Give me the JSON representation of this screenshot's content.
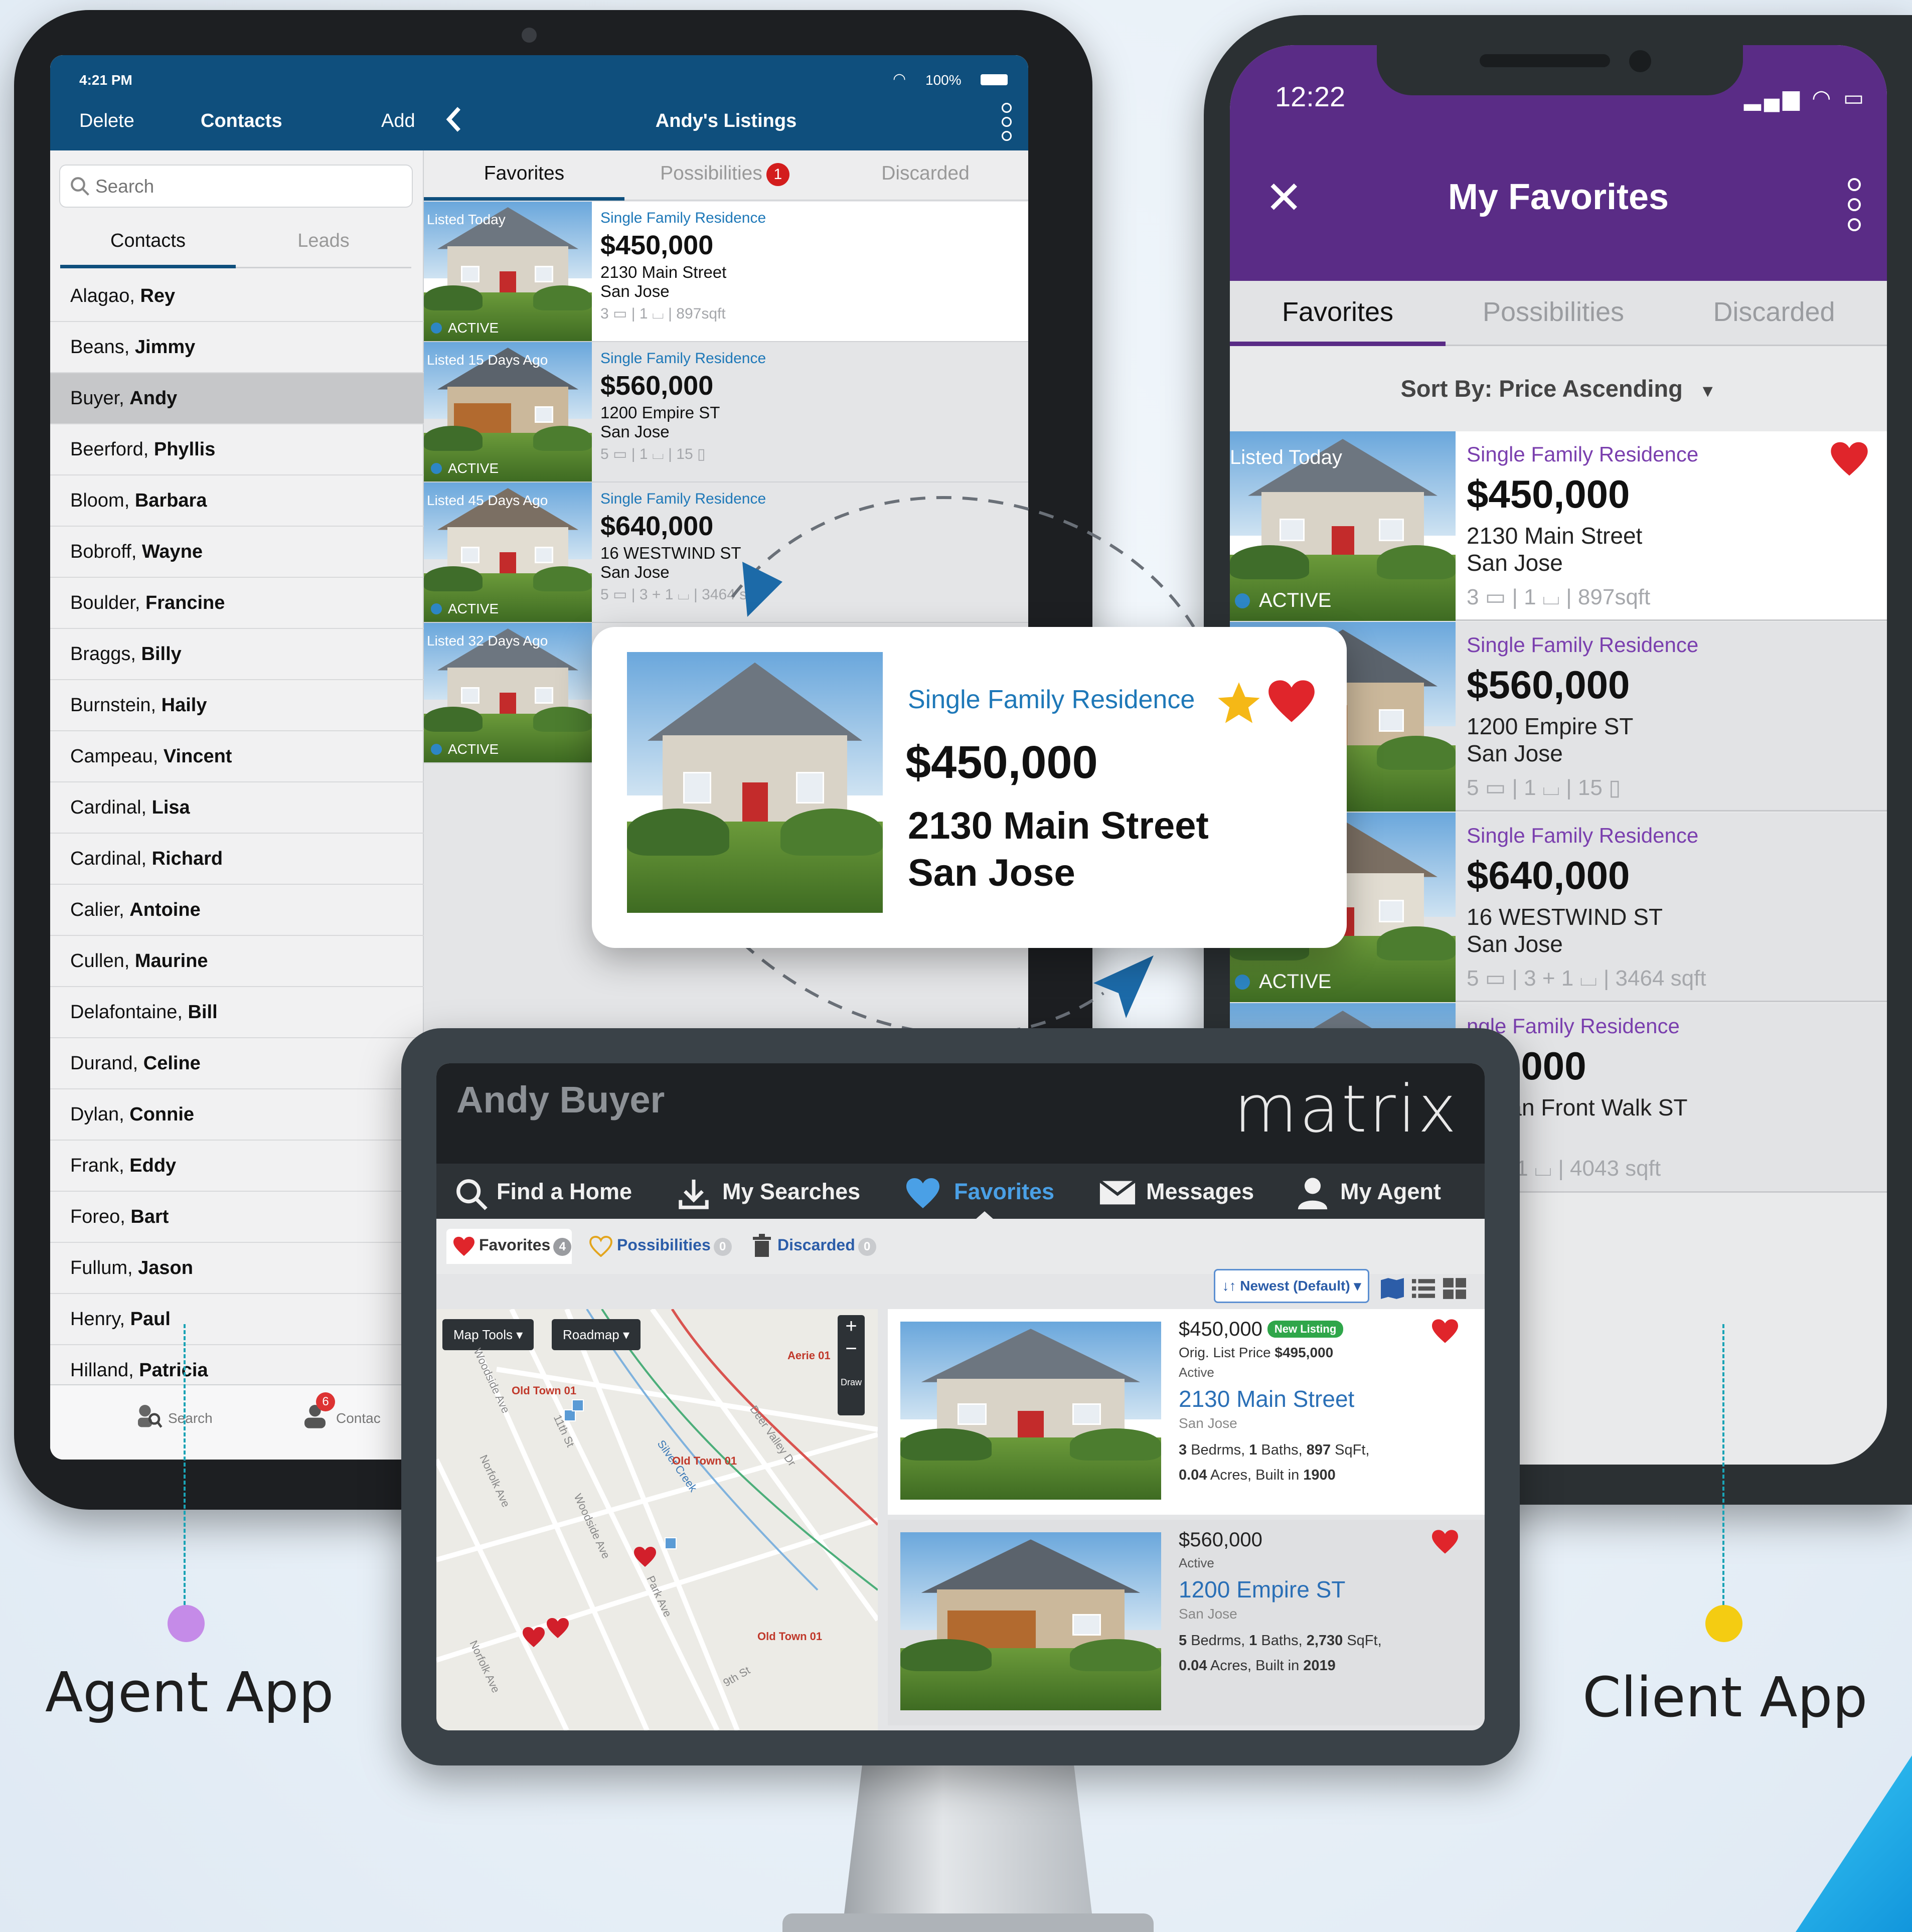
{
  "agent_app": {
    "status": {
      "time": "4:21 PM",
      "battery": "100%"
    },
    "left_header": {
      "delete": "Delete",
      "title": "Contacts",
      "add": "Add"
    },
    "search_placeholder": "Search",
    "segments": [
      "Contacts",
      "Leads"
    ],
    "contacts": [
      {
        "last": "Alagao",
        "first": "Rey",
        "selected": false
      },
      {
        "last": "Beans",
        "first": "Jimmy",
        "selected": false
      },
      {
        "last": "Buyer",
        "first": "Andy",
        "selected": true
      },
      {
        "last": "Beerford",
        "first": "Phyllis",
        "selected": false
      },
      {
        "last": "Bloom",
        "first": "Barbara",
        "selected": false
      },
      {
        "last": "Bobroff",
        "first": "Wayne",
        "selected": false
      },
      {
        "last": "Boulder",
        "first": "Francine",
        "selected": false
      },
      {
        "last": "Braggs",
        "first": "Billy",
        "selected": false
      },
      {
        "last": "Burnstein",
        "first": "Haily",
        "selected": false
      },
      {
        "last": "Campeau",
        "first": "Vincent",
        "selected": false
      },
      {
        "last": "Cardinal",
        "first": "Lisa",
        "selected": false
      },
      {
        "last": "Cardinal",
        "first": "Richard",
        "selected": false
      },
      {
        "last": "Calier",
        "first": "Antoine",
        "selected": false
      },
      {
        "last": "Cullen",
        "first": "Maurine",
        "selected": false
      },
      {
        "last": "Delafontaine",
        "first": "Bill",
        "selected": false
      },
      {
        "last": "Durand",
        "first": "Celine",
        "selected": false
      },
      {
        "last": "Dylan",
        "first": "Connie",
        "selected": false
      },
      {
        "last": "Frank",
        "first": "Eddy",
        "selected": false
      },
      {
        "last": "Foreo",
        "first": "Bart",
        "selected": false
      },
      {
        "last": "Fullum",
        "first": "Jason",
        "selected": false
      },
      {
        "last": "Henry",
        "first": "Paul",
        "selected": false
      },
      {
        "last": "Hilland",
        "first": "Patricia",
        "selected": false
      }
    ],
    "tabbar": {
      "search": "Search",
      "contacts": "Contac",
      "contacts_badge": "6"
    },
    "right_header": {
      "title": "Andy's Listings"
    },
    "listing_tabs": {
      "favorites": "Favorites",
      "possibilities": "Possibilities",
      "possibilities_badge": "1",
      "discarded": "Discarded"
    },
    "listings": [
      {
        "age": "Listed Today",
        "status": "ACTIVE",
        "type": "Single Family Residence",
        "price": "$450,000",
        "street": "2130 Main Street",
        "city": "San Jose",
        "meta": "3 ▭ | 1 ⌴ | 897sqft",
        "highlight": true
      },
      {
        "age": "Listed 15 Days Ago",
        "status": "ACTIVE",
        "type": "Single Family Residence",
        "price": "$560,000",
        "street": "1200 Empire ST",
        "city": "San Jose",
        "meta": "5 ▭ | 1 ⌴ | 15 ▯",
        "highlight": false
      },
      {
        "age": "Listed 45 Days Ago",
        "status": "ACTIVE",
        "type": "Single Family Residence",
        "price": "$640,000",
        "street": "16 WESTWIND ST",
        "city": "San Jose",
        "meta": "5 ▭ | 3 + 1 ⌴ | 3464 sqft",
        "highlight": false
      },
      {
        "age": "Listed 32 Days Ago",
        "status": "ACTIVE",
        "type": "",
        "price": "",
        "street": "",
        "city": "",
        "meta": "",
        "highlight": false
      }
    ]
  },
  "popup": {
    "type": "Single Family Residence",
    "price": "$450,000",
    "street": "2130 Main Street",
    "city": "San Jose"
  },
  "client_app": {
    "time": "12:22",
    "title": "My Favorites",
    "tabs": [
      "Favorites",
      "Possibilities",
      "Discarded"
    ],
    "sort": "Sort By: Price Ascending",
    "listings": [
      {
        "age": "Listed Today",
        "status": "ACTIVE",
        "type": "Single Family Residence",
        "price": "$450,000",
        "street": "2130 Main Street",
        "city": "San Jose",
        "meta": "3 ▭ | 1 ⌴ | 897sqft",
        "favorited": true
      },
      {
        "age": "ys Ago",
        "status": "",
        "type": "Single Family Residence",
        "price": "$560,000",
        "street": "1200 Empire ST",
        "city": "San Jose",
        "meta": "5 ▭ | 1 ⌴ | 15 ▯",
        "favorited": false
      },
      {
        "age": "ys Ago",
        "status": "ACTIVE",
        "type": "Single Family Residence",
        "price": "$640,000",
        "street": "16 WESTWIND ST",
        "city": "San Jose",
        "meta": "5 ▭ | 3 + 1 ⌴ | 3464 sqft",
        "favorited": false
      },
      {
        "age": "",
        "status": "",
        "type": "ngle Family Residence",
        "price": "59,000",
        "street": "Ocean Front Walk ST",
        "city": "ose",
        "meta": "| 5 + 1 ⌴ | 4043 sqft",
        "favorited": false
      }
    ]
  },
  "matrix": {
    "user": "Andy Buyer",
    "brand": "matrix",
    "nav": [
      "Find a Home",
      "My Searches",
      "Favorites",
      "Messages",
      "My Agent"
    ],
    "subtabs": {
      "favorites": "Favorites",
      "favorites_count": "4",
      "possibilities": "Possibilities",
      "possibilities_count": "0",
      "discarded": "Discarded",
      "discarded_count": "0"
    },
    "sort": "↓↑ Newest (Default) ▾",
    "map": {
      "tools": "Map Tools ▾",
      "roadmap": "Roadmap ▾",
      "zoom_in": "+",
      "zoom_out": "−",
      "draw": "Draw",
      "streets": [
        "Woodside Ave",
        "11th St",
        "Norfolk Ave",
        "Woodside Ave",
        "Park Ave",
        "9th St",
        "Deer Valley Dr",
        "Silver Creek",
        "Norfolk Ave"
      ],
      "towns": [
        "Old Town 01",
        "Old Town 01",
        "Old Town 01",
        "Aerie 01"
      ]
    },
    "listings": [
      {
        "price": "$450,000",
        "new_badge": "New Listing",
        "orig_label": "Orig. List Price",
        "orig_price": "$495,000",
        "status": "Active",
        "street": "2130 Main Street",
        "city": "San Jose",
        "beds": "3",
        "baths": "1",
        "sqft": "897",
        "acres": "0.04",
        "built": "1900"
      },
      {
        "price": "$560,000",
        "new_badge": "",
        "orig_label": "",
        "orig_price": "",
        "status": "Active",
        "street": "1200 Empire ST",
        "city": "San Jose",
        "beds": "5",
        "baths": "1",
        "sqft": "2,730",
        "acres": "0.04",
        "built": "2019"
      }
    ]
  },
  "captions": {
    "agent": "Agent App",
    "client": "Client App"
  },
  "colors": {
    "agent_blue": "#0f4f7d",
    "client_purple": "#5a2c86",
    "heart_red": "#e0252b",
    "agent_dot": "#c58be8",
    "client_dot": "#f4cc12",
    "link_blue": "#1e78b8"
  }
}
